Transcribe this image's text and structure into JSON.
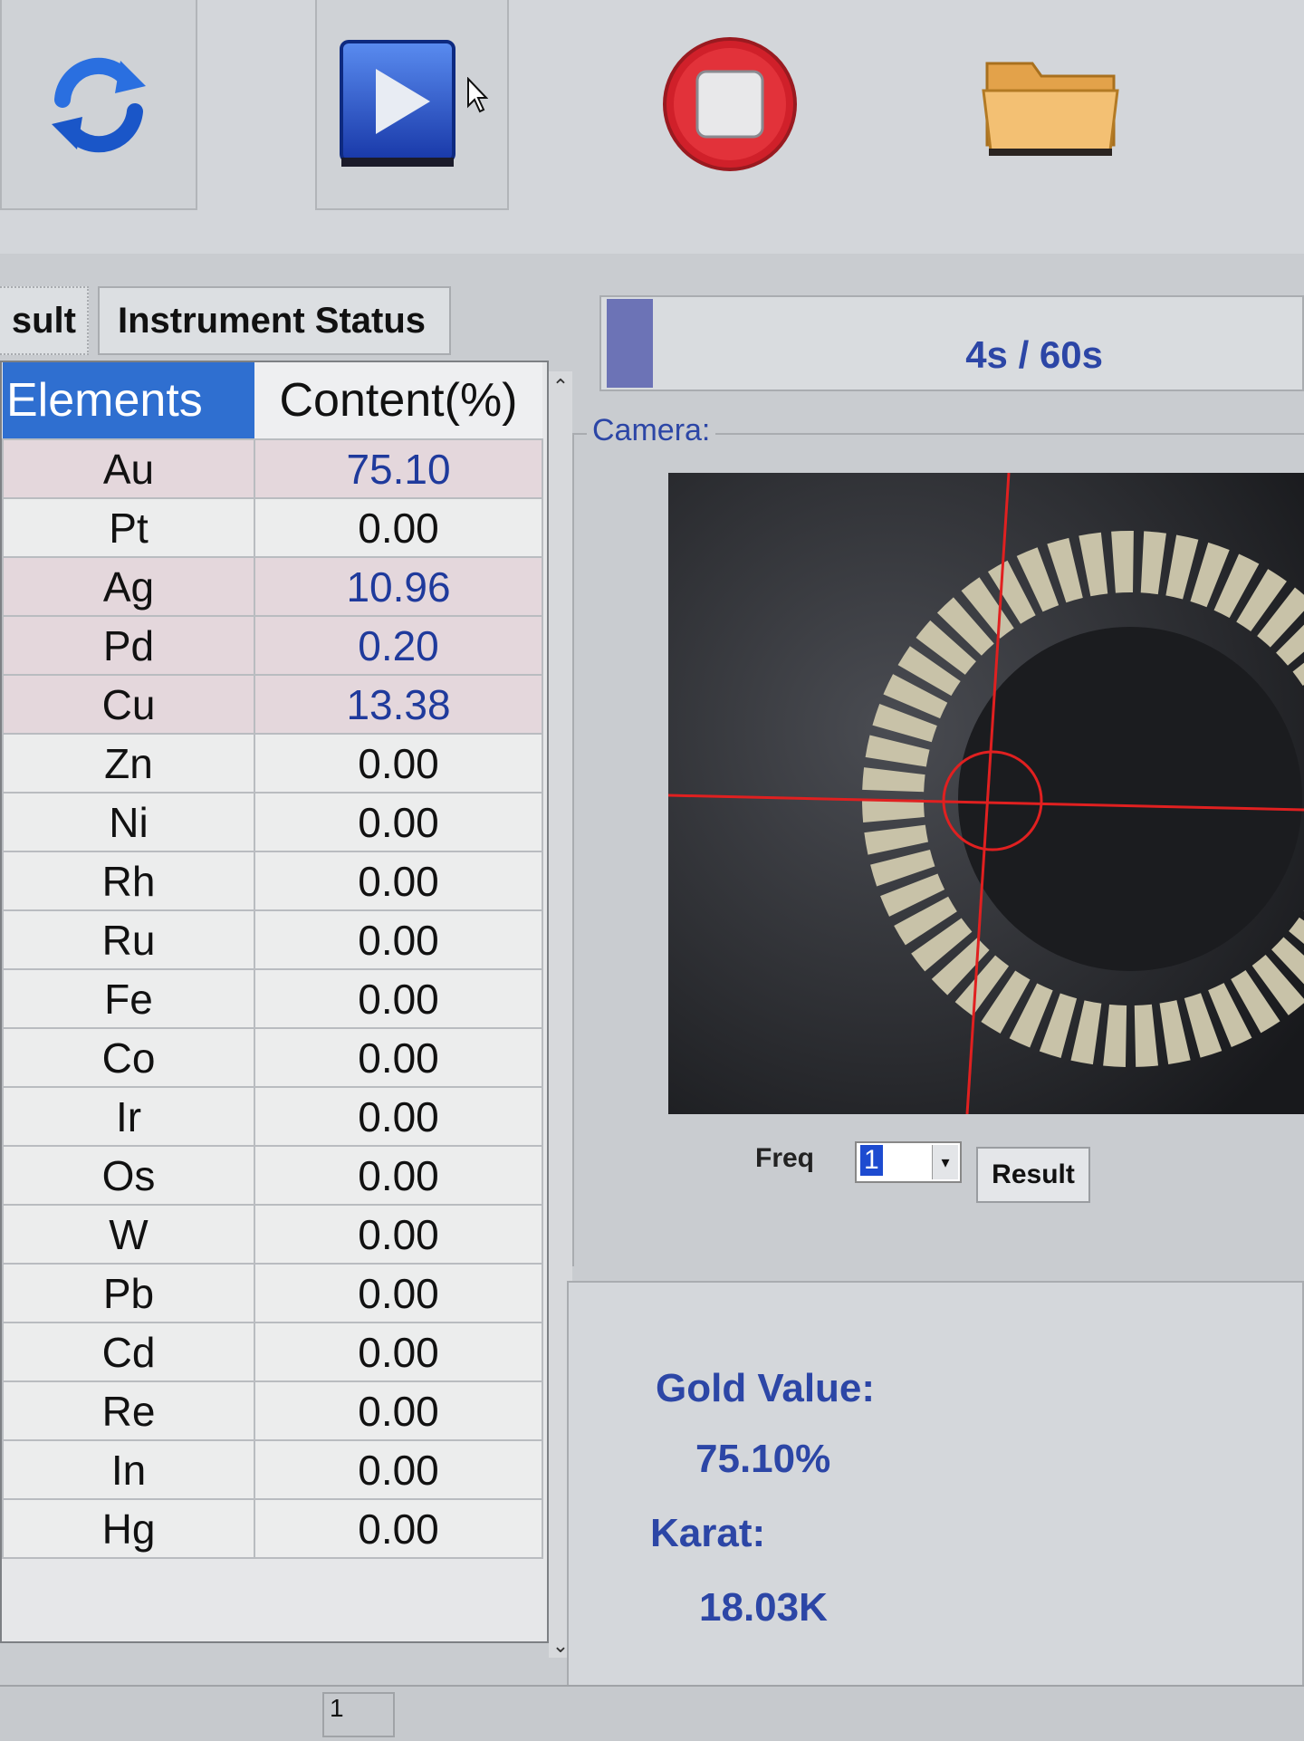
{
  "toolbar": {
    "buttons": [
      {
        "icon": "refresh-icon"
      },
      {
        "icon": "play-icon"
      },
      {
        "icon": "stop-icon"
      },
      {
        "icon": "folder-open-icon"
      }
    ]
  },
  "tabs": {
    "result_label": "sult",
    "status_label": "Instrument Status"
  },
  "table": {
    "headers": {
      "elements": "Elements",
      "content": "Content(%)"
    },
    "rows": [
      {
        "element": "Au",
        "content": "75.10"
      },
      {
        "element": "Pt",
        "content": "0.00"
      },
      {
        "element": "Ag",
        "content": "10.96"
      },
      {
        "element": "Pd",
        "content": "0.20"
      },
      {
        "element": "Cu",
        "content": "13.38"
      },
      {
        "element": "Zn",
        "content": "0.00"
      },
      {
        "element": "Ni",
        "content": "0.00"
      },
      {
        "element": "Rh",
        "content": "0.00"
      },
      {
        "element": "Ru",
        "content": "0.00"
      },
      {
        "element": "Fe",
        "content": "0.00"
      },
      {
        "element": "Co",
        "content": "0.00"
      },
      {
        "element": "Ir",
        "content": "0.00"
      },
      {
        "element": "Os",
        "content": "0.00"
      },
      {
        "element": "W",
        "content": "0.00"
      },
      {
        "element": "Pb",
        "content": "0.00"
      },
      {
        "element": "Cd",
        "content": "0.00"
      },
      {
        "element": "Re",
        "content": "0.00"
      },
      {
        "element": "In",
        "content": "0.00"
      },
      {
        "element": "Hg",
        "content": "0.00"
      }
    ]
  },
  "progress": {
    "text": "4s / 60s",
    "fraction": 0.0667
  },
  "camera": {
    "label": "Camera:",
    "freq_label": "Freq",
    "freq_value": "1",
    "result_button": "Result"
  },
  "gold": {
    "value_label": "Gold Value:",
    "value": "75.10%",
    "karat_label": "Karat:",
    "karat": "18.03K"
  },
  "statusbar": {
    "page": "1"
  },
  "colors": {
    "accent": "#2f6fd0",
    "value_text": "#2c46a6",
    "highlight_row": "#e4d7dc"
  }
}
